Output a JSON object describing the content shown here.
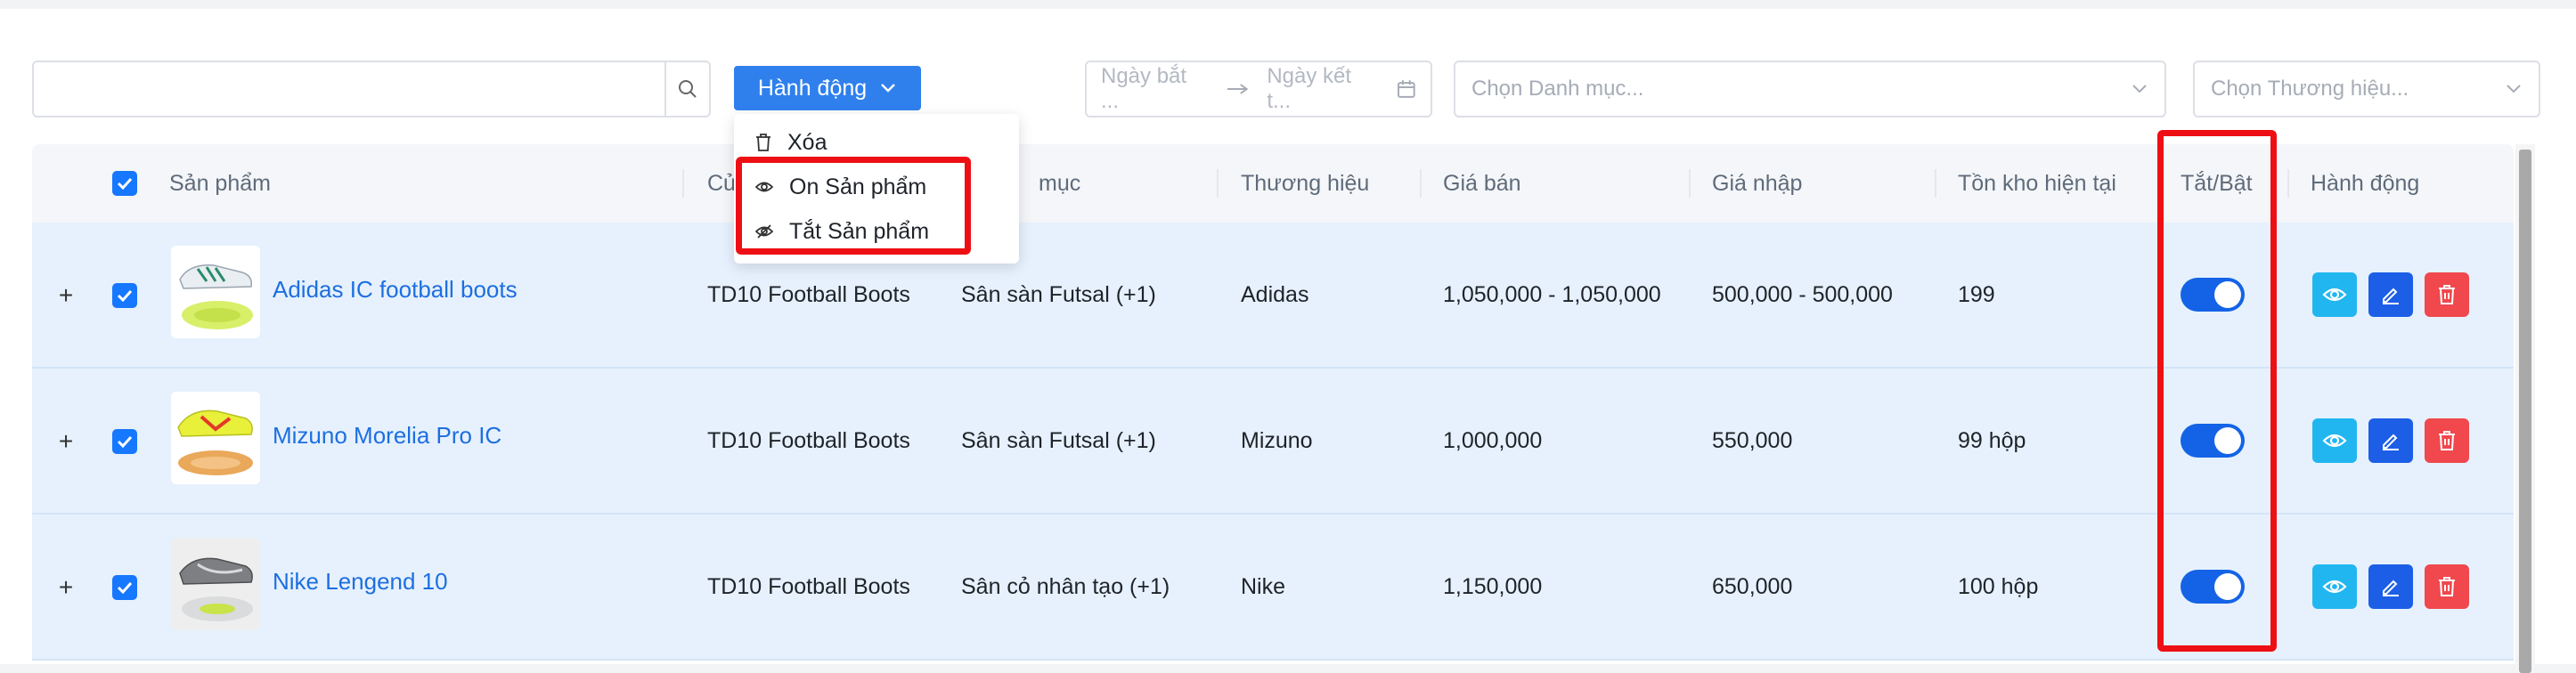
{
  "toolbar": {
    "search_placeholder": "",
    "action_label": "Hành động",
    "date_start_placeholder": "Ngày bắt ...",
    "date_end_placeholder": "Ngày kết t...",
    "category_placeholder": "Chọn Danh mục...",
    "brand_placeholder": "Chọn Thương hiệu..."
  },
  "menu": {
    "items": [
      {
        "label": "Xóa",
        "icon": "trash-icon"
      },
      {
        "label": "On Sản phẩm",
        "icon": "eye-icon"
      },
      {
        "label": "Tắt Sản phẩm",
        "icon": "eye-off-icon"
      }
    ]
  },
  "table": {
    "headers": {
      "product": "Sản phẩm",
      "store": "Cử",
      "category": "mục",
      "brand": "Thương hiệu",
      "price": "Giá bán",
      "cost": "Giá nhập",
      "stock": "Tồn kho hiện tại",
      "toggle": "Tắt/Bật",
      "actions": "Hành động"
    },
    "rows": [
      {
        "name": "Adidas IC football boots",
        "store": "TD10 Football Boots",
        "category": "Sân sàn Futsal (+1)",
        "brand": "Adidas",
        "price": "1,050,000 - 1,050,000",
        "cost": "500,000 - 500,000",
        "stock": "199",
        "enabled": true,
        "checked": true
      },
      {
        "name": "Mizuno Morelia Pro IC",
        "store": "TD10 Football Boots",
        "category": "Sân sàn Futsal (+1)",
        "brand": "Mizuno",
        "price": "1,000,000",
        "cost": "550,000",
        "stock": "99 hộp",
        "enabled": true,
        "checked": true
      },
      {
        "name": "Nike Lengend 10",
        "store": "TD10 Football Boots",
        "category": "Sân cỏ nhân tạo (+1)",
        "brand": "Nike",
        "price": "1,150,000",
        "cost": "650,000",
        "stock": "100 hộp",
        "enabled": true,
        "checked": true
      }
    ]
  },
  "colors": {
    "primary": "#2f80ed",
    "row_selected": "#e6f1fd",
    "highlight": "#ee0f14",
    "view": "#21b6f0",
    "edit": "#1c5fe6",
    "delete": "#f0484d"
  }
}
